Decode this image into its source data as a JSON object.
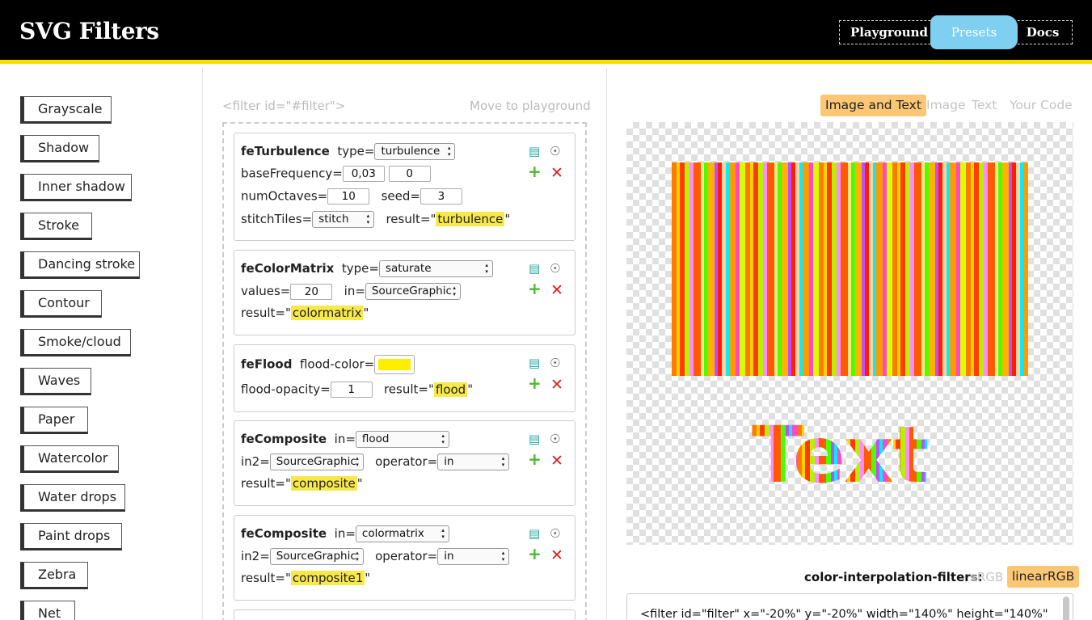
{
  "header": {
    "title": "SVG Filters",
    "nav": [
      "Playground",
      "Presets",
      "Docs"
    ],
    "active_nav": "Presets"
  },
  "presets": [
    "Grayscale",
    "Shadow",
    "Inner shadow",
    "Stroke",
    "Dancing stroke",
    "Contour",
    "Smoke/cloud",
    "Waves",
    "Paper",
    "Watercolor",
    "Water drops",
    "Paint drops",
    "Zebra",
    "Net"
  ],
  "editor": {
    "filter_tag": "<filter id=\"#filter\">",
    "move_label": "Move to playground",
    "primitives": [
      {
        "name": "feTurbulence",
        "type_label": "type=",
        "type_value": "turbulence",
        "basefreq_label": "baseFrequency=",
        "basefreq_x": "0,03",
        "basefreq_y": "0",
        "octaves_label": "numOctaves=",
        "octaves_value": "10",
        "seed_label": "seed=",
        "seed_value": "3",
        "stitch_label": "stitchTiles=",
        "stitch_value": "stitch",
        "result_label": "result=\"",
        "result_value": "turbulence",
        "result_close": "\""
      },
      {
        "name": "feColorMatrix",
        "type_label": "type=",
        "type_value": "saturate",
        "values_label": "values=",
        "values_value": "20",
        "in_label": "in=",
        "in_value": "SourceGraphic",
        "result_label": "result=\"",
        "result_value": "colormatrix",
        "result_close": "\""
      },
      {
        "name": "feFlood",
        "color_label": "flood-color=",
        "color_value": "#ffee00",
        "opacity_label": "flood-opacity=",
        "opacity_value": "1",
        "result_label": "result=\"",
        "result_value": "flood",
        "result_close": "\""
      },
      {
        "name": "feComposite",
        "in_label": "in=",
        "in_value": "flood",
        "in2_label": "in2=",
        "in2_value": "SourceGraphic",
        "operator_label": "operator=",
        "operator_value": "in",
        "result_label": "result=\"",
        "result_value": "composite",
        "result_close": "\""
      },
      {
        "name": "feComposite",
        "in_label": "in=",
        "in_value": "colormatrix",
        "in2_label": "in2=",
        "in2_value": "SourceGraphic",
        "operator_label": "operator=",
        "operator_value": "in",
        "result_label": "result=\"",
        "result_value": "composite1",
        "result_close": "\""
      }
    ]
  },
  "preview": {
    "tabs": [
      "Image and Text",
      "Image",
      "Text",
      "Your Code"
    ],
    "active_tab": "Image and Text",
    "sample_text": "Text",
    "cif_label": "color-interpolation-filters:",
    "cif_options": [
      "sRGB",
      "linearRGB"
    ],
    "cif_active": "linearRGB",
    "code_line": "<filter id=\"filter\" x=\"-20%\" y=\"-20%\" width=\"140%\" height=\"140%\""
  },
  "colors": {
    "header_bg": "#000000",
    "accent_yellow": "#f6df00",
    "nav_active": "#7fd0f0",
    "tab_active": "#fbc774",
    "highlight": "#f8e94a",
    "add_green": "#4cb82e",
    "delete_red": "#e21d1d"
  },
  "icons": [
    "document-icon",
    "eye-slash-icon",
    "plus-icon",
    "close-icon",
    "select-arrows-icon"
  ]
}
